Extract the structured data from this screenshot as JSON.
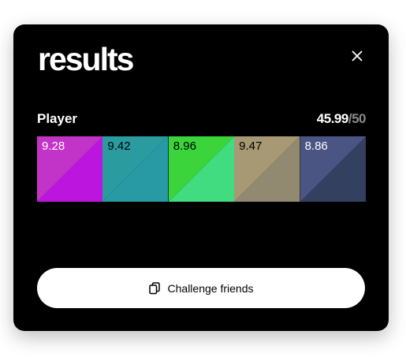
{
  "modal": {
    "title": "results",
    "close_icon": "close-icon"
  },
  "player": {
    "name": "Player",
    "score_total": "45.99",
    "score_separator": "/",
    "score_max": "50"
  },
  "tiles": [
    {
      "value": "9.28",
      "color_a": "#c233c8",
      "color_b": "#bc16de",
      "text_color": "#ffffff"
    },
    {
      "value": "9.42",
      "color_a": "#2a9b9f",
      "color_b": "#279aa4",
      "text_color": "#000000"
    },
    {
      "value": "8.96",
      "color_a": "#3bd43b",
      "color_b": "#41dc7f",
      "text_color": "#000000"
    },
    {
      "value": "9.47",
      "color_a": "#a69973",
      "color_b": "#928a70",
      "text_color": "#000000"
    },
    {
      "value": "8.86",
      "color_a": "#4b5584",
      "color_b": "#33405f",
      "text_color": "#ffffff"
    }
  ],
  "actions": {
    "challenge_label": "Challenge friends",
    "challenge_icon": "copy-icon"
  }
}
